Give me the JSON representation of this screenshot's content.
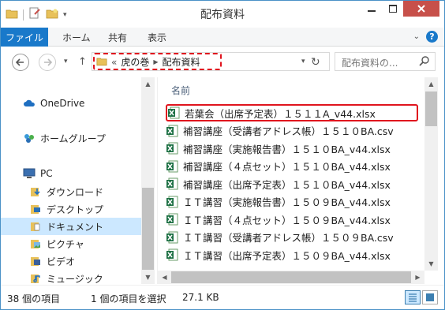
{
  "window": {
    "title": "配布資料"
  },
  "ribbon": {
    "file_tab": "ファイル",
    "tabs": [
      "ホーム",
      "共有",
      "表示"
    ]
  },
  "address": {
    "prefix": "«",
    "crumbs": [
      "虎の巻",
      "配布資料"
    ]
  },
  "search": {
    "placeholder": "配布資料の..."
  },
  "sidebar": {
    "items": [
      {
        "label": "OneDrive",
        "icon": "cloud-icon"
      },
      {
        "label": "ホームグループ",
        "icon": "homegroup-icon"
      },
      {
        "label": "PC",
        "icon": "computer-icon"
      },
      {
        "label": "ダウンロード",
        "icon": "download-folder-icon"
      },
      {
        "label": "デスクトップ",
        "icon": "desktop-folder-icon"
      },
      {
        "label": "ドキュメント",
        "icon": "documents-folder-icon",
        "selected": true
      },
      {
        "label": "ピクチャ",
        "icon": "pictures-folder-icon"
      },
      {
        "label": "ビデオ",
        "icon": "videos-folder-icon"
      },
      {
        "label": "ミュージック",
        "icon": "music-folder-icon"
      }
    ]
  },
  "filelist": {
    "column_name": "名前",
    "files": [
      "若葉会（出席予定表）１５１１A_v44.xlsx",
      "補習講座（受講者アドレス帳）１５１０BA.csv",
      "補習講座（実施報告書）１５１０BA_v44.xlsx",
      "補習講座（４点セット）１５１０BA_v44.xlsx",
      "補習講座（出席予定表）１５１０BA_v44.xlsx",
      "ＩＴ講習（実施報告書）１５０９BA_v44.xlsx",
      "ＩＴ講習（４点セット）１５０９BA_v44.xlsx",
      "ＩＴ講習（受講者アドレス帳）１５０９BA.csv",
      "ＩＴ講習（出席予定表）１５０９BA_v44.xlsx"
    ]
  },
  "status": {
    "count": "38 個の項目",
    "selection": "1 個の項目を選択",
    "size": "27.1 KB"
  },
  "colors": {
    "accent": "#1979ca",
    "highlight": "#e0141e",
    "excel": "#1e7145"
  }
}
